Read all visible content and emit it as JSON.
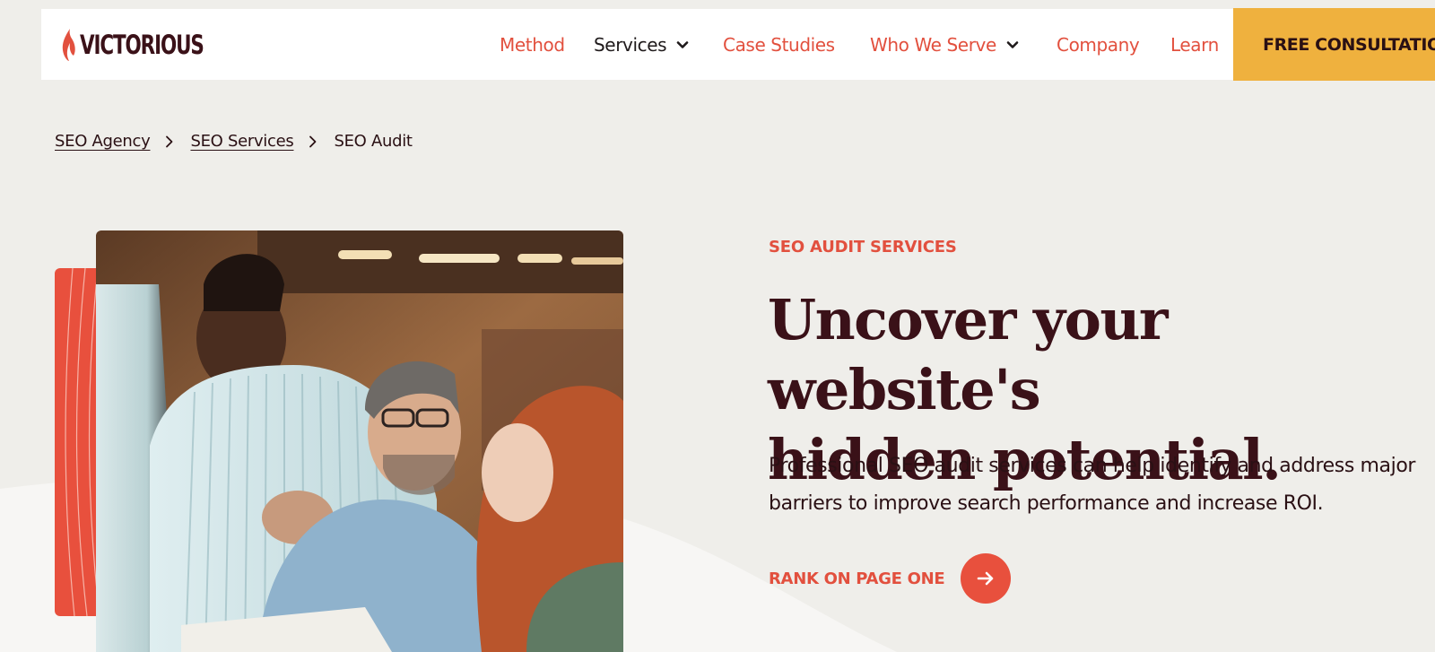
{
  "brand": {
    "logo_text": "VICTORIOUS",
    "primary_color": "#e2503e",
    "accent_color": "#efb13e",
    "dark_color": "#3a1118"
  },
  "nav": {
    "items": [
      {
        "label": "Method",
        "active": false,
        "has_dropdown": false
      },
      {
        "label": "Services",
        "active": true,
        "has_dropdown": true
      },
      {
        "label": "Case Studies",
        "active": false,
        "has_dropdown": false
      },
      {
        "label": "Who We Serve",
        "active": false,
        "has_dropdown": true
      },
      {
        "label": "Company",
        "active": false,
        "has_dropdown": false
      },
      {
        "label": "Learn",
        "active": false,
        "has_dropdown": false
      }
    ],
    "cta_label": "FREE CONSULTATION"
  },
  "breadcrumb": {
    "items": [
      "SEO Agency",
      "SEO Services"
    ],
    "current": "SEO Audit"
  },
  "hero": {
    "eyebrow": "SEO AUDIT SERVICES",
    "title_line1": "Uncover your website's",
    "title_line2": "hidden potential.",
    "subtitle_line1": "Professional SEO audit services can help identify and address major",
    "subtitle_line2": "barriers to improve search performance and increase ROI.",
    "cta_label": "RANK ON PAGE ONE",
    "cta_icon": "arrow-right-icon",
    "image_alt": "team-working-at-computer-photo"
  }
}
